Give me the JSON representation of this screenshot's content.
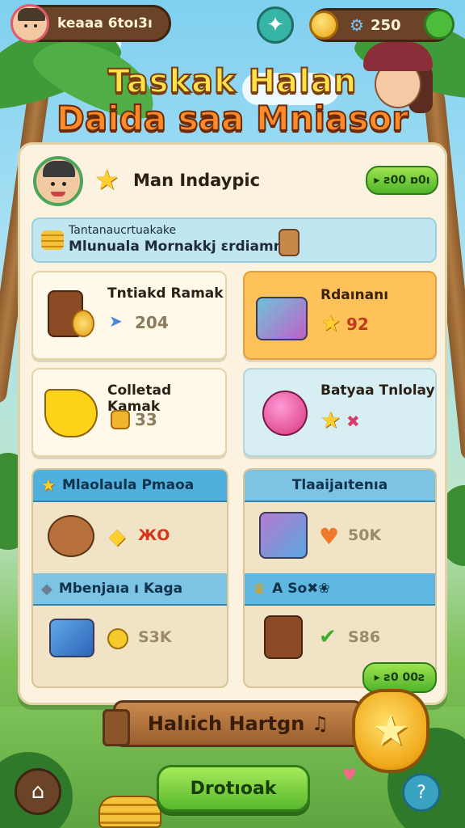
{
  "colors": {
    "accent_green": "#58b82c",
    "hud_brown": "#6b4326",
    "title_yellow": "#ffe24a",
    "title_orange": "#ff8a2a",
    "panel_bg": "#fbf3df",
    "section_blue": "#4fb0dd",
    "highlight_orange": "#ffc25a"
  },
  "hud": {
    "player_name": "keaaa 6toı3ı",
    "currency_value": "250",
    "center_icon": "star-icon",
    "currency_icon": "gold-coin-icon",
    "settings_icon": "gear-icon"
  },
  "titles": {
    "line1": "Taskak Halan",
    "line2": "Daida saa Mniasor"
  },
  "profile": {
    "name": "Man Indaypic",
    "badge": "▸ ƨ00 ɒ0ı"
  },
  "banner": {
    "line1": "Tantanaucrtuakake",
    "line2": "Mlunuala Mornakkj ɛrdiamnn"
  },
  "cards": [
    {
      "label": "Tntiakd Ramak",
      "value": "204",
      "value_color": "#8a7c5c"
    },
    {
      "label": "Rdaınanı",
      "value": "92",
      "value_color": "#c23a1a"
    },
    {
      "label": "Colletad Kamak",
      "value": "33",
      "value_color": "#8a7c5c"
    },
    {
      "label": "Batyaa Tnlolay",
      "value": "✖",
      "value_color": "#d83a6a"
    }
  ],
  "sections": {
    "left": {
      "header": "Mlaolaula Pmaoa",
      "row1_value": "ЖO",
      "subheader": "Mbenjaıa ı Kaga",
      "row2_value": "S3K"
    },
    "right": {
      "header": "Tlaaijaıtenıa",
      "row1_value": "50K",
      "subheader": "A So✖❀",
      "row2_value": "S86"
    }
  },
  "bottom_pill": "▸ ƨ0 00ƨ",
  "wood_sign": "Halıich Hartgn ♫",
  "main_button": "Drotıoak",
  "back_icon": "home-arrow-icon",
  "help_icon": "help-icon"
}
